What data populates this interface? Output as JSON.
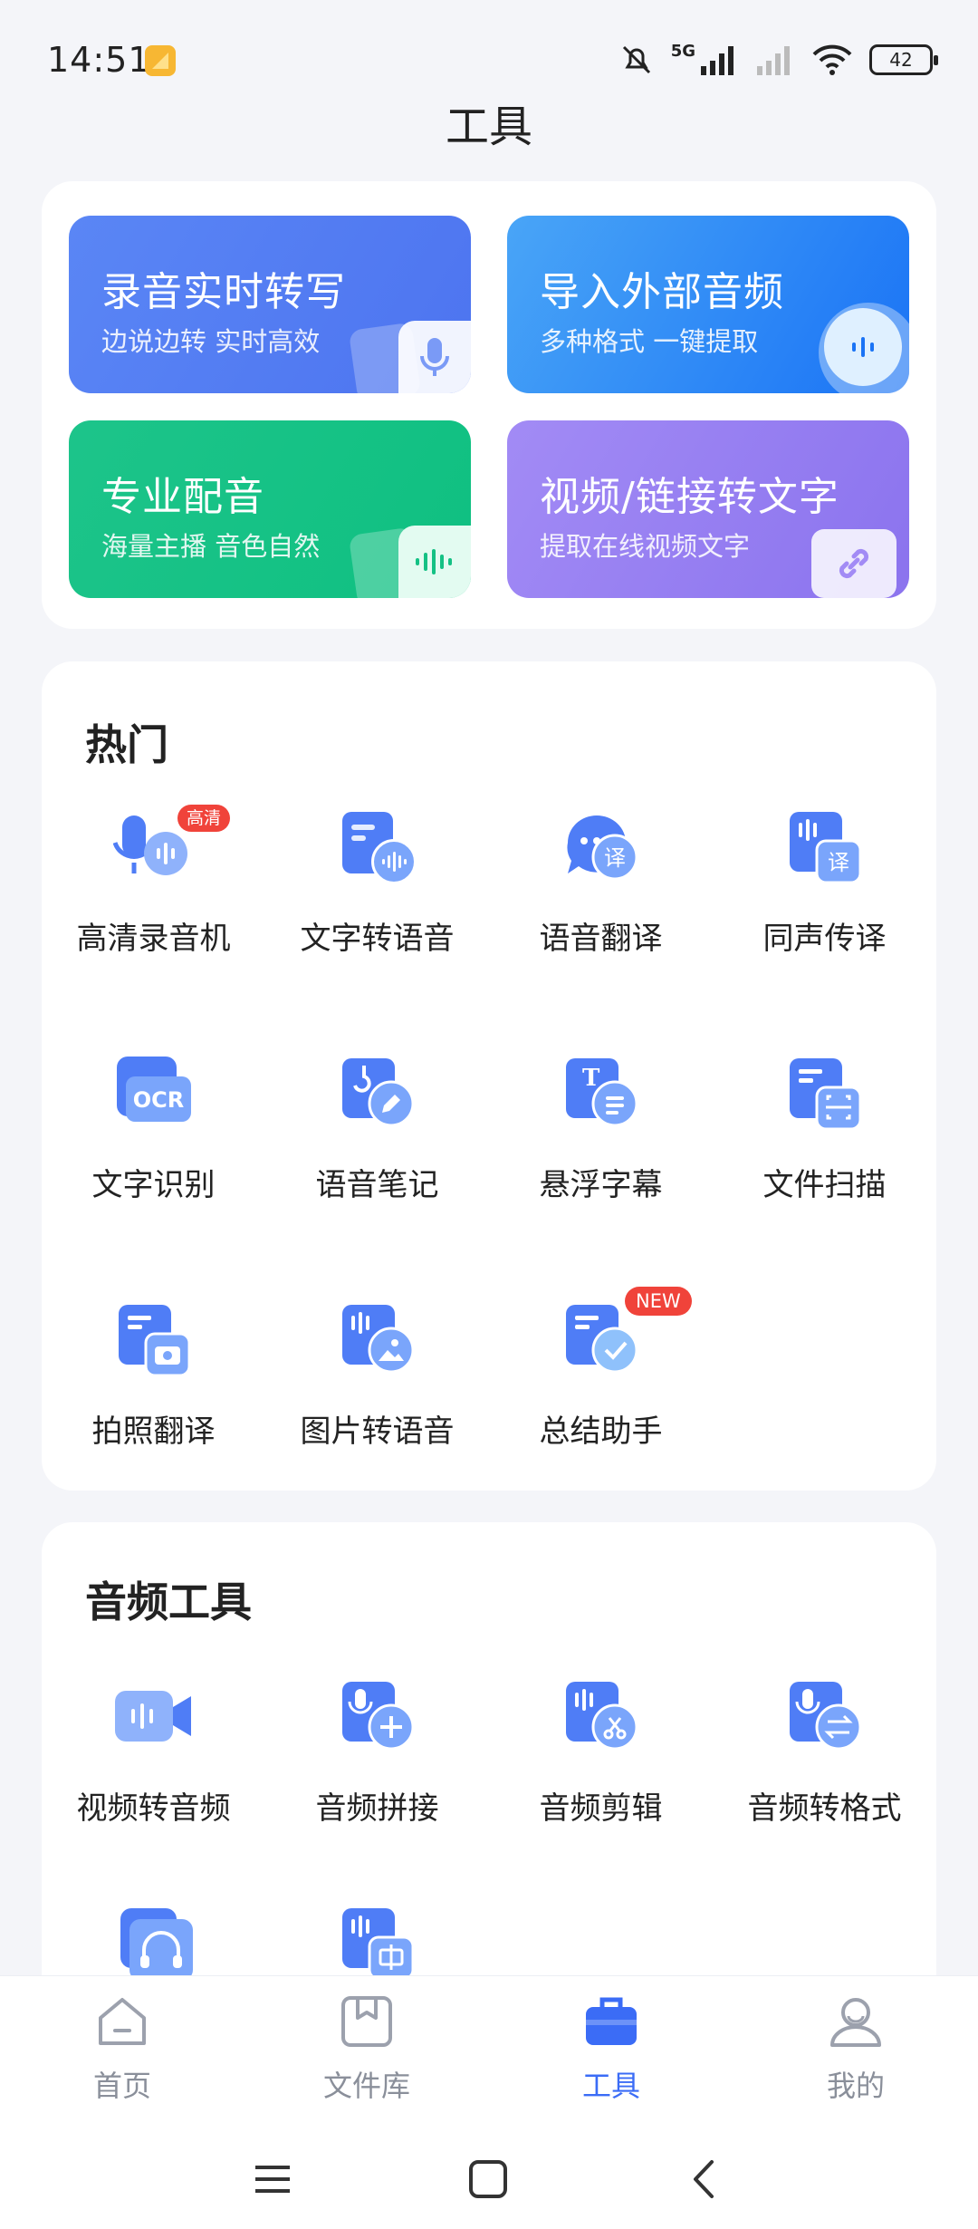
{
  "status_bar": {
    "time": "14:51",
    "network": "5G",
    "battery": "42"
  },
  "page": {
    "title": "工具"
  },
  "features": [
    {
      "title": "录音实时转写",
      "subtitle": "边说边转 实时高效",
      "icon": "mic-icon"
    },
    {
      "title": "导入外部音频",
      "subtitle": "多种格式 一键提取",
      "icon": "audio-wave-icon"
    },
    {
      "title": "专业配音",
      "subtitle": "海量主播 音色自然",
      "icon": "sound-wave-icon"
    },
    {
      "title": "视频/链接转文字",
      "subtitle": "提取在线视频文字",
      "icon": "link-icon"
    }
  ],
  "hot": {
    "title": "热门",
    "items": [
      {
        "label": "高清录音机",
        "badge": "高清",
        "icon": "hd-recorder-icon"
      },
      {
        "label": "文字转语音",
        "icon": "text-to-speech-icon"
      },
      {
        "label": "语音翻译",
        "icon": "voice-translate-icon"
      },
      {
        "label": "同声传译",
        "icon": "simultaneous-interpretation-icon"
      },
      {
        "label": "文字识别",
        "icon": "ocr-icon"
      },
      {
        "label": "语音笔记",
        "icon": "voice-note-icon"
      },
      {
        "label": "悬浮字幕",
        "icon": "floating-subtitle-icon"
      },
      {
        "label": "文件扫描",
        "icon": "file-scan-icon"
      },
      {
        "label": "拍照翻译",
        "icon": "photo-translate-icon"
      },
      {
        "label": "图片转语音",
        "icon": "image-to-speech-icon"
      },
      {
        "label": "总结助手",
        "badge": "NEW",
        "icon": "summary-assistant-icon"
      }
    ]
  },
  "audio_tools": {
    "title": "音频工具",
    "items": [
      {
        "label": "视频转音频",
        "icon": "video-to-audio-icon"
      },
      {
        "label": "音频拼接",
        "icon": "audio-merge-icon"
      },
      {
        "label": "音频剪辑",
        "icon": "audio-cut-icon"
      },
      {
        "label": "音频转格式",
        "icon": "audio-convert-icon"
      },
      {
        "label": "",
        "icon": "headphones-icon"
      },
      {
        "label": "",
        "icon": "audio-middle-icon"
      }
    ]
  },
  "nav": {
    "items": [
      {
        "label": "首页",
        "icon": "home-icon"
      },
      {
        "label": "文件库",
        "icon": "library-icon"
      },
      {
        "label": "工具",
        "icon": "toolbox-icon",
        "active": true
      },
      {
        "label": "我的",
        "icon": "profile-icon"
      }
    ]
  },
  "colors": {
    "accent": "#3b6cf6",
    "icon_blue": "#4f7df6",
    "badge_red": "#f0433a"
  }
}
